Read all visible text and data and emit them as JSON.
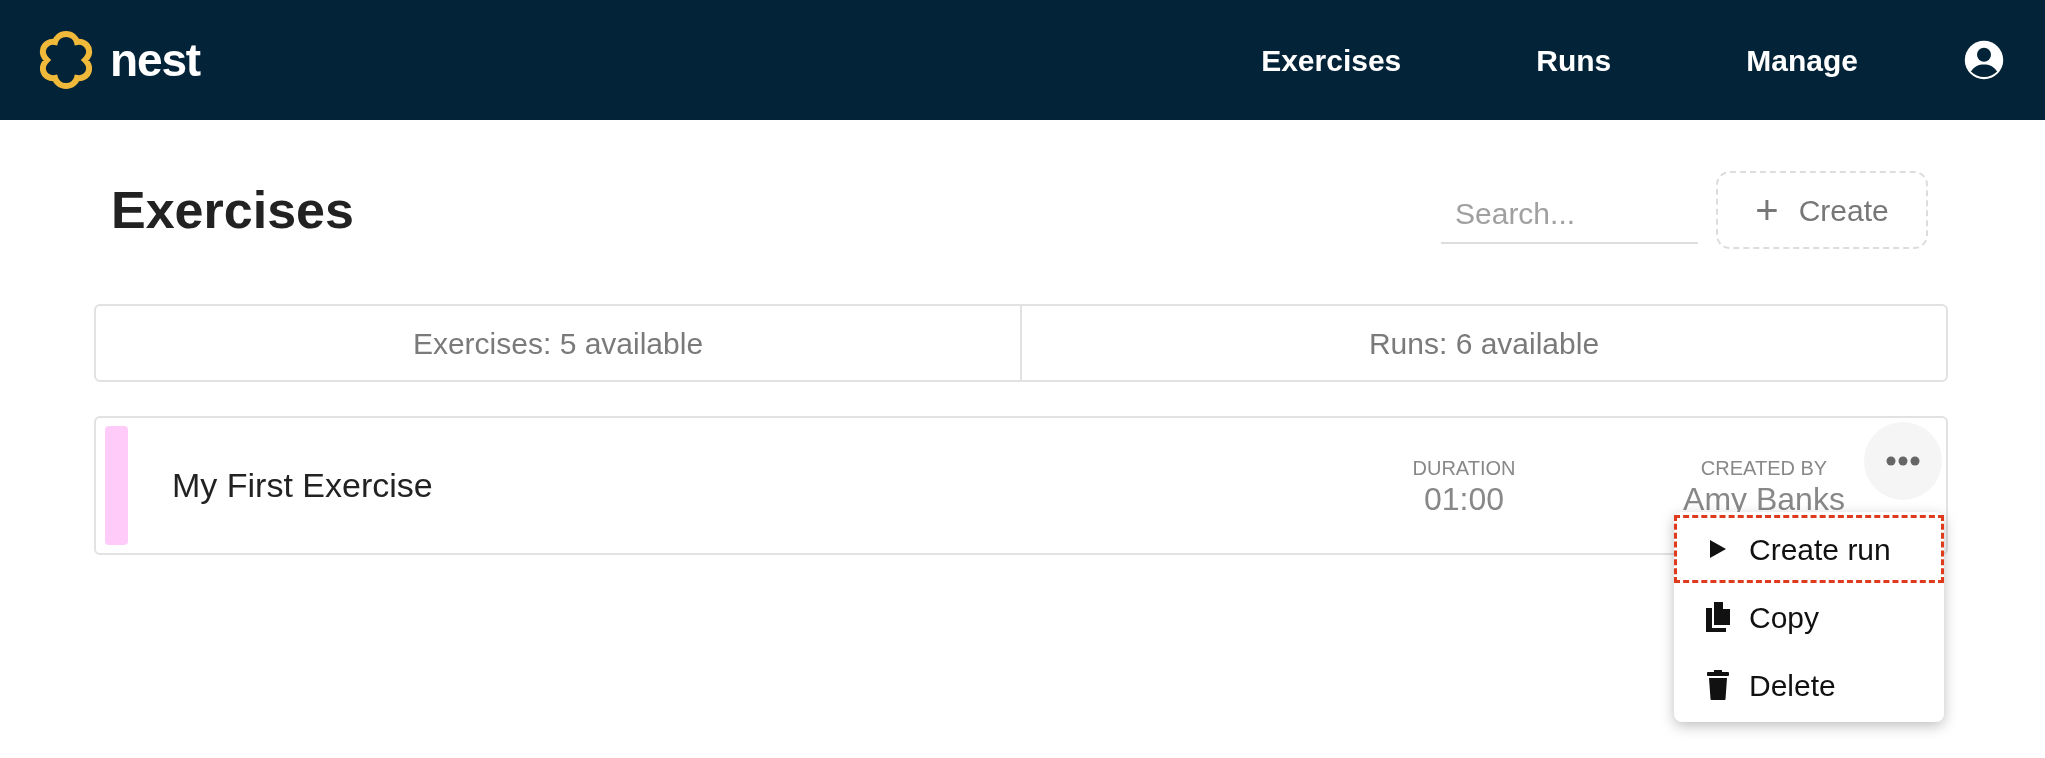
{
  "brand": "nest",
  "nav": [
    {
      "label": "Exercises"
    },
    {
      "label": "Runs"
    },
    {
      "label": "Manage"
    }
  ],
  "page_title": "Exercises",
  "search": {
    "placeholder": "Search..."
  },
  "create_button": {
    "icon": "+",
    "label": "Create"
  },
  "stats": [
    {
      "label": "Exercises: 5 available"
    },
    {
      "label": "Runs: 6 available"
    }
  ],
  "exercises": [
    {
      "name": "My First Exercise",
      "color": "#ffccf9",
      "duration_label": "DURATION",
      "duration": "01:00",
      "created_by_label": "CREATED BY",
      "created_by": "Amy Banks"
    }
  ],
  "menu": [
    {
      "kind": "play",
      "label": "Create run",
      "highlighted": true
    },
    {
      "kind": "copy",
      "label": "Copy",
      "highlighted": false
    },
    {
      "kind": "delete",
      "label": "Delete",
      "highlighted": false
    }
  ]
}
